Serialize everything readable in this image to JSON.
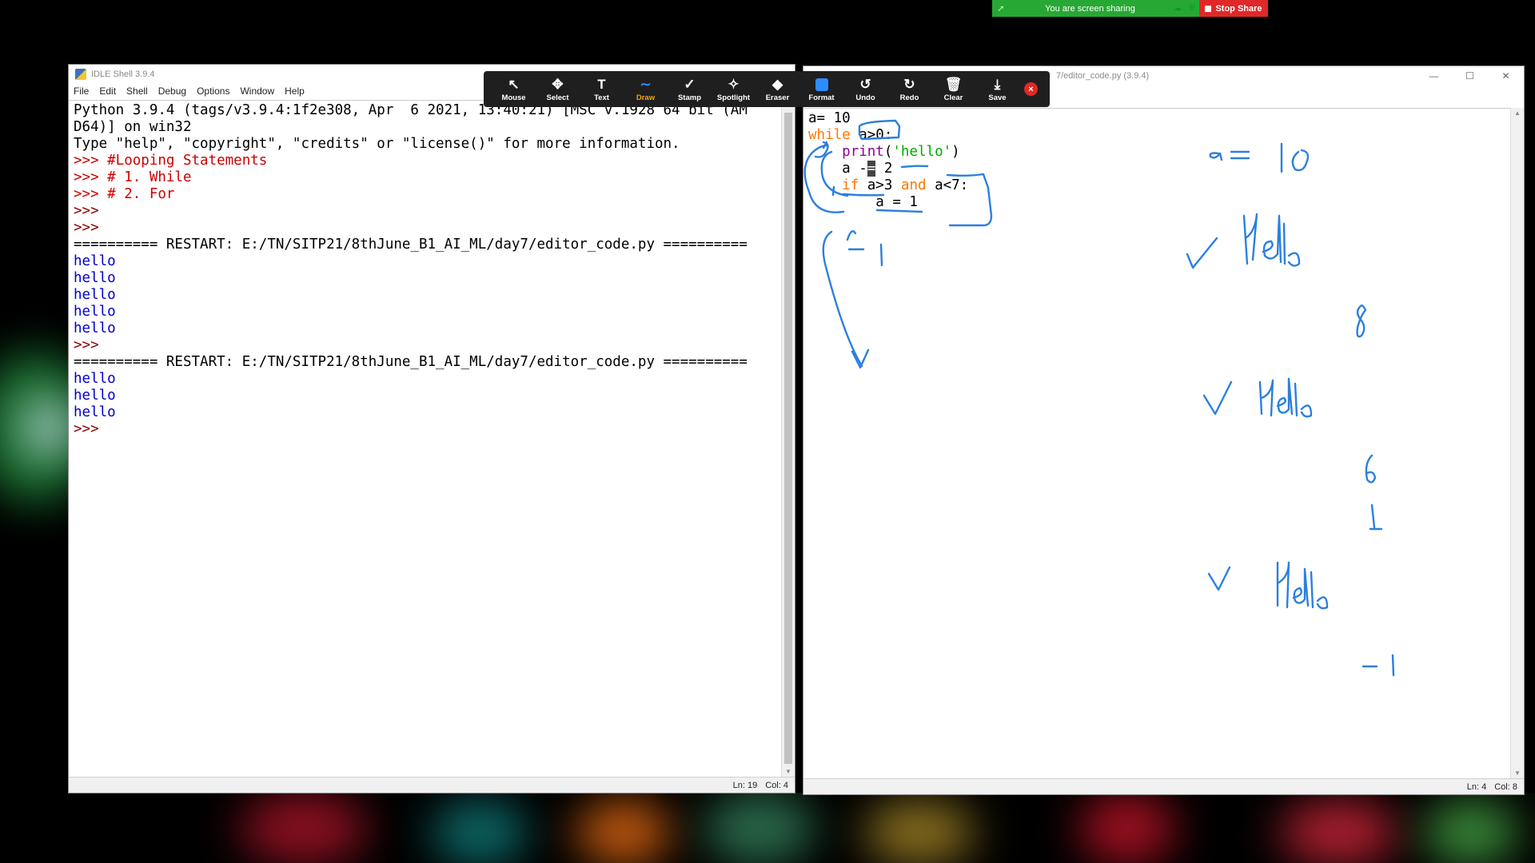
{
  "share_bar": {
    "status": "You are screen sharing",
    "stop_label": "Stop Share"
  },
  "annotate_toolbar": {
    "tools": [
      {
        "label": "Mouse",
        "icon": "mouse-pointer-icon",
        "glyph": "↖"
      },
      {
        "label": "Select",
        "icon": "move-icon",
        "glyph": "✥"
      },
      {
        "label": "Text",
        "icon": "text-icon",
        "glyph": "T"
      },
      {
        "label": "Draw",
        "icon": "draw-icon",
        "glyph": "∼"
      },
      {
        "label": "Stamp",
        "icon": "checkmark-icon",
        "glyph": "✓"
      },
      {
        "label": "Spotlight",
        "icon": "spotlight-icon",
        "glyph": "✧"
      },
      {
        "label": "Eraser",
        "icon": "eraser-icon",
        "glyph": "◆"
      },
      {
        "label": "Format",
        "icon": "format-icon",
        "glyph": ""
      },
      {
        "label": "Undo",
        "icon": "undo-icon",
        "glyph": "↺"
      },
      {
        "label": "Redo",
        "icon": "redo-icon",
        "glyph": "↻"
      },
      {
        "label": "Clear",
        "icon": "trash-icon",
        "glyph": "🗑"
      },
      {
        "label": "Save",
        "icon": "save-icon",
        "glyph": "⤓"
      }
    ],
    "active_tool": "Draw",
    "close_glyph": "×"
  },
  "shell": {
    "title": "IDLE Shell 3.9.4",
    "menu": [
      "File",
      "Edit",
      "Shell",
      "Debug",
      "Options",
      "Window",
      "Help"
    ],
    "lines": [
      {
        "t": "Python 3.9.4 (tags/v3.9.4:1f2e308, Apr  6 2021, 13:40:21) [MSC v.1928 64 bit (AM",
        "c": "blk"
      },
      {
        "t": "D64)] on win32",
        "c": "blk"
      },
      {
        "t": "Type \"help\", \"copyright\", \"credits\" or \"license()\" for more information.",
        "c": "blk"
      },
      {
        "t": ">>> #Looping Statements",
        "c": "red"
      },
      {
        "t": ">>> # 1. While",
        "c": "red"
      },
      {
        "t": ">>> # 2. For",
        "c": "red"
      },
      {
        "t": ">>>",
        "c": "brn"
      },
      {
        "t": ">>>",
        "c": "brn"
      },
      {
        "t": "========== RESTART: E:/TN/SITP21/8thJune_B1_AI_ML/day7/editor_code.py ==========",
        "c": "blk"
      },
      {
        "t": "hello",
        "c": "blu"
      },
      {
        "t": "hello",
        "c": "blu"
      },
      {
        "t": "hello",
        "c": "blu"
      },
      {
        "t": "hello",
        "c": "blu"
      },
      {
        "t": "hello",
        "c": "blu"
      },
      {
        "t": ">>>",
        "c": "brn"
      },
      {
        "t": "========== RESTART: E:/TN/SITP21/8thJune_B1_AI_ML/day7/editor_code.py ==========",
        "c": "blk"
      },
      {
        "t": "hello",
        "c": "blu"
      },
      {
        "t": "hello",
        "c": "blu"
      },
      {
        "t": "hello",
        "c": "blu"
      },
      {
        "t": ">>>",
        "c": "brn"
      }
    ],
    "status_ln": "Ln: 19",
    "status_col": "Col: 4"
  },
  "editor": {
    "title": "7/editor_code.py (3.9.4)",
    "code": {
      "l1": "a= 10",
      "l2_kw": "while",
      "l2_rest": " a>0:",
      "l3_indent": "    ",
      "l3_fn": "print",
      "l3_p1": "(",
      "l3_str": "'hello'",
      "l3_p2": ")",
      "l4_a": "    a -",
      "l4_cur": "=",
      "l4_b": " 2",
      "l5_indent": "    ",
      "l5_kw1": "if",
      "l5_mid": " a>3 ",
      "l5_kw2": "and",
      "l5_end": " a<7:",
      "l6": "        a = 1"
    },
    "status_ln": "Ln: 4",
    "status_col": "Col: 8"
  },
  "colors": {
    "ink": "#2b7fe0",
    "zoom_green": "#27a834",
    "zoom_red": "#e02828",
    "idle_keyword": "#ff7700"
  }
}
